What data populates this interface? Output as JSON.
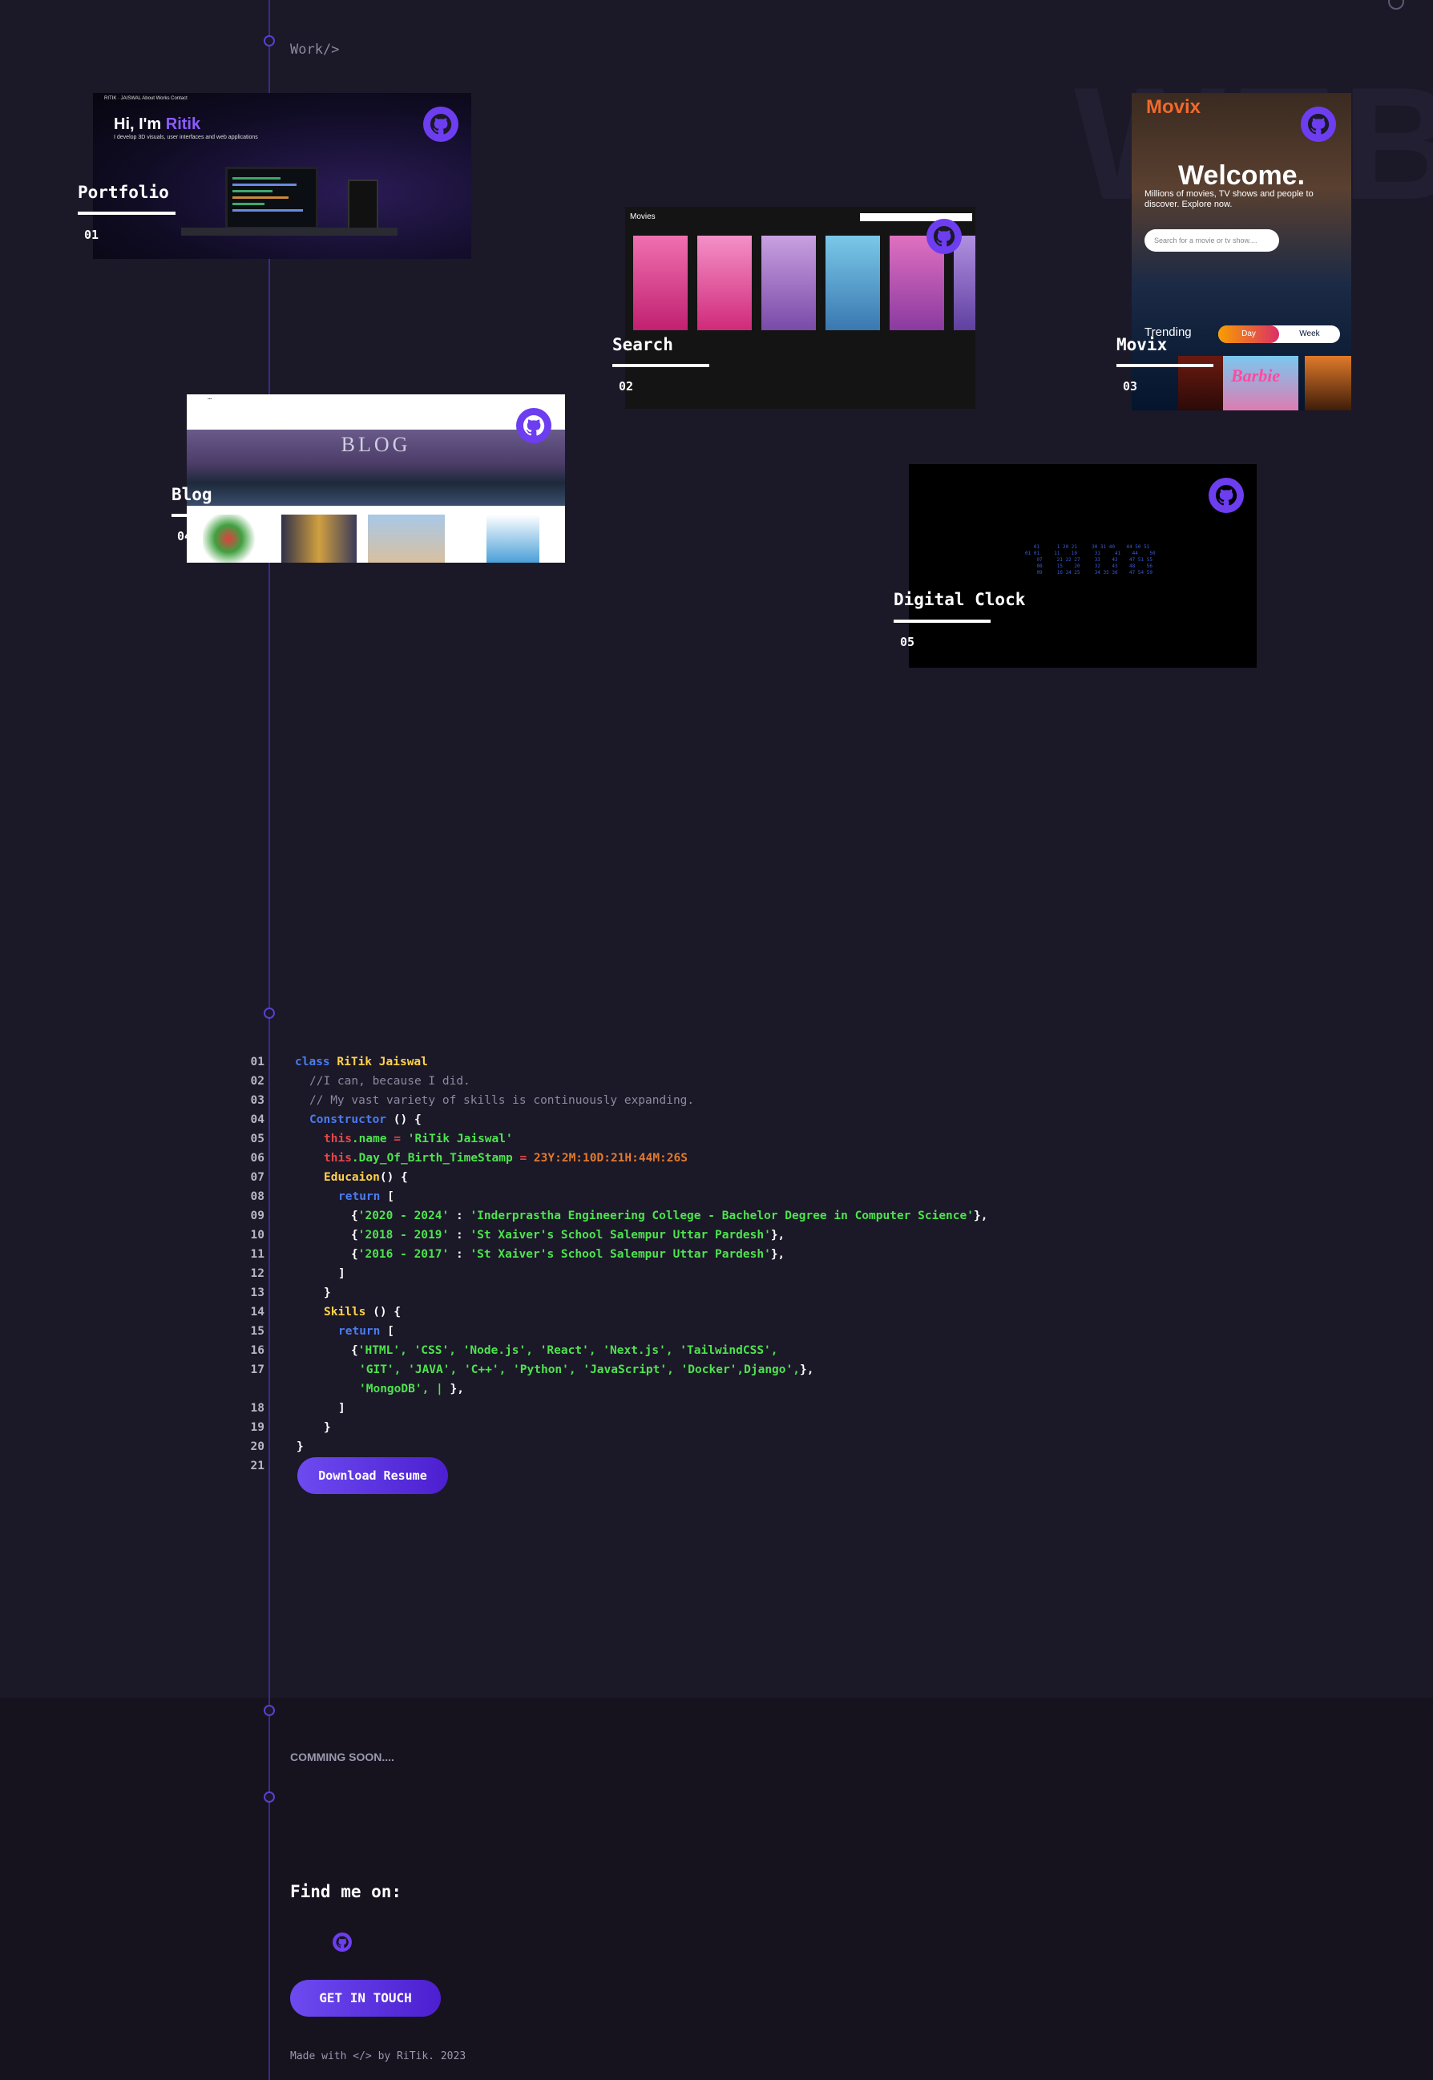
{
  "work_label": "Work/>",
  "watermark": "WEB",
  "projects": [
    {
      "title": "Portfolio",
      "number": "01"
    },
    {
      "title": "Search",
      "number": "02"
    },
    {
      "title": "Movix",
      "number": "03"
    },
    {
      "title": "Blog",
      "number": "04"
    },
    {
      "title": "Digital Clock",
      "number": "05"
    }
  ],
  "portfolio_preview": {
    "hero_prefix": "Hi, I'm ",
    "hero_name": "Ritik",
    "hero_sub": "I develop 3D visuals, user interfaces and web applications",
    "nav": "RITIK · JAISWAL        About   Works   Contact"
  },
  "search_preview": {
    "header": "Movies"
  },
  "movix_preview": {
    "logo": "Movix",
    "welcome": "Welcome.",
    "tagline": "Millions of movies, TV shows and people to discover. Explore now.",
    "search_placeholder": "Search for a movie or tv show....",
    "trending": "Trending",
    "day": "Day",
    "week": "Week",
    "card_text": "Barbie"
  },
  "blog_preview": {
    "hero_text": "BLOG"
  },
  "code": [
    {
      "n": "01"
    },
    {
      "n": "02"
    },
    {
      "n": "03"
    },
    {
      "n": "04"
    },
    {
      "n": "05"
    },
    {
      "n": "06"
    },
    {
      "n": "07"
    },
    {
      "n": "08"
    },
    {
      "n": "09"
    },
    {
      "n": "10"
    },
    {
      "n": "11"
    },
    {
      "n": "12"
    },
    {
      "n": "13"
    },
    {
      "n": "14"
    },
    {
      "n": "15"
    },
    {
      "n": "16"
    },
    {
      "n": "17"
    },
    {
      "n": ""
    },
    {
      "n": "18"
    },
    {
      "n": "19"
    },
    {
      "n": "20"
    },
    {
      "n": "21"
    }
  ],
  "code_text": {
    "class_kw": "class",
    "class_name": "RiTik Jaiswal",
    "c1": "//I can, because I did.",
    "c2": "// My vast variety of skills is continuously expanding.",
    "ctor": "Constructor",
    "ctor_tail": " () {",
    "this": "this",
    "name_prop": ".name",
    "eq": " = ",
    "name_val": "'RiTik Jaiswal'",
    "dob_prop": ".Day_Of_Birth_TimeStamp",
    "dob_val": "23Y:2M:10D:21H:44M:26S",
    "edu": "Educaion",
    "edu_tail": "() {",
    "ret": "return",
    "ret_tail": " [",
    "e1k": "'2020 - 2024'",
    "e1v": "'Inderprastha Engineering College - Bachelor Degree in Computer Science'",
    "e2k": "'2018 - 2019'",
    "e2v": "'St Xaiver's School Salempur Uttar Pardesh'",
    "e3k": "'2016 - 2017'",
    "e3v": "'St Xaiver's School Salempur Uttar Pardesh'",
    "close_br": "]",
    "close_cb": "}",
    "skills": "Skills",
    "skills_tail": " () {",
    "s1": "'HTML', 'CSS', 'Node.js', 'React', 'Next.js', 'TailwindCSS',",
    "s2": "'GIT', 'JAVA', 'C++', 'Python', 'JavaScript', 'Docker',Django',",
    "s3": "'MongoDB', | "
  },
  "download_resume": "Download Resume",
  "coming_soon": "COMMING SOON....",
  "find_me": "Find me on:",
  "get_in_touch": "GET IN TOUCH",
  "made_with": "Made with </> by RiTik. 2023",
  "colors": {
    "accent": "#6d3df0",
    "background": "#1b1828",
    "footer": "#16131f"
  }
}
